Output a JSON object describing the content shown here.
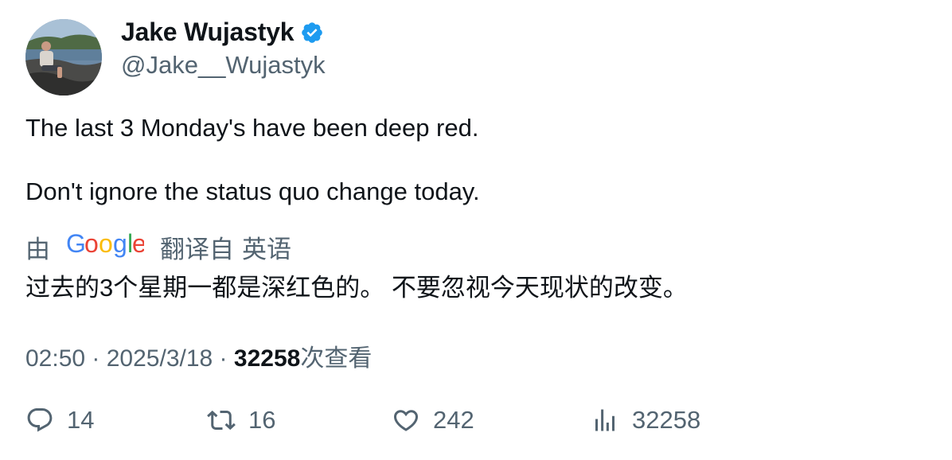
{
  "author": {
    "display_name": "Jake Wujastyk",
    "handle": "@Jake__Wujastyk",
    "verified": true,
    "avatar_icon": "profile-photo"
  },
  "tweet": {
    "line1": "The last 3 Monday's have been deep red.",
    "line2": "Don't ignore the status quo change today."
  },
  "translation": {
    "by_label": "由",
    "provider": "Google",
    "translated_from_label": "翻译自",
    "language": "英语",
    "text": "过去的3个星期一都是深红色的。 不要忽视今天现状的改变。"
  },
  "meta": {
    "time": "02:50",
    "date": "2025/3/18",
    "separator": " · ",
    "views_count": "32258",
    "views_label": "次查看"
  },
  "actions": {
    "replies": "14",
    "retweets": "16",
    "likes": "242",
    "views": "32258"
  },
  "colors": {
    "text_primary": "#0f1419",
    "text_secondary": "#536471",
    "verified_blue": "#1d9bf0"
  }
}
